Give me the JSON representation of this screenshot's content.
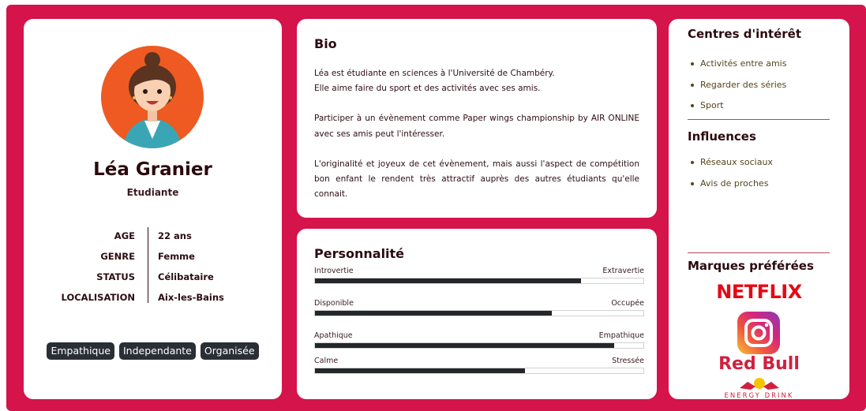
{
  "profile": {
    "name": "Léa Granier",
    "role": "Etudiante",
    "facts": [
      {
        "key": "AGE",
        "value": "22 ans"
      },
      {
        "key": "GENRE",
        "value": "Femme"
      },
      {
        "key": "STATUS",
        "value": "Célibataire"
      },
      {
        "key": "LOCALISATION",
        "value": "Aix-les-Bains"
      }
    ],
    "tags": [
      "Empathique",
      "Independante",
      "Organisée"
    ]
  },
  "bio": {
    "title": "Bio",
    "paragraphs": [
      "Léa est étudiante en sciences à l'Université de Chambéry.\nElle aime faire du sport et des activités avec ses amis.",
      "Participer à un évènement comme Paper wings championship by AIR ONLINE avec ses amis peut l'intéresser.",
      "L'originalité et joyeux de cet évènement, mais aussi l'aspect de compétition bon enfant le rendent très attractif auprès des autres étudiants qu'elle connait."
    ]
  },
  "personality": {
    "title": "Personnalité",
    "traits": [
      {
        "left": "Introvertie",
        "right": "Extravertie",
        "level": 0.81
      },
      {
        "left": "Disponible",
        "right": "Occupée",
        "level": 0.72
      },
      {
        "left": "Apathique",
        "right": "Empathique",
        "level": 0.91
      },
      {
        "left": "Calme",
        "right": "Stressée",
        "level": 0.64
      }
    ]
  },
  "interests": {
    "title": "Centres d'intérêt",
    "items": [
      "Activités entre amis",
      "Regarder des séries",
      "Sport"
    ]
  },
  "influences": {
    "title": "Influences",
    "items": [
      "Réseaux sociaux",
      "Avis de proches"
    ]
  },
  "brands": {
    "title": "Marques préférées",
    "netflix": "NETFLIX",
    "redbull": "Red Bull",
    "redbull_tagline": "ENERGY DRINK"
  },
  "colors": {
    "frame": "#d4144a",
    "bar_fill": "#24262b",
    "avatar_bg": "#ee5a21"
  },
  "icons": [
    "avatar-illustration",
    "instagram-logo-icon",
    "red-bull-bulls-icon"
  ]
}
